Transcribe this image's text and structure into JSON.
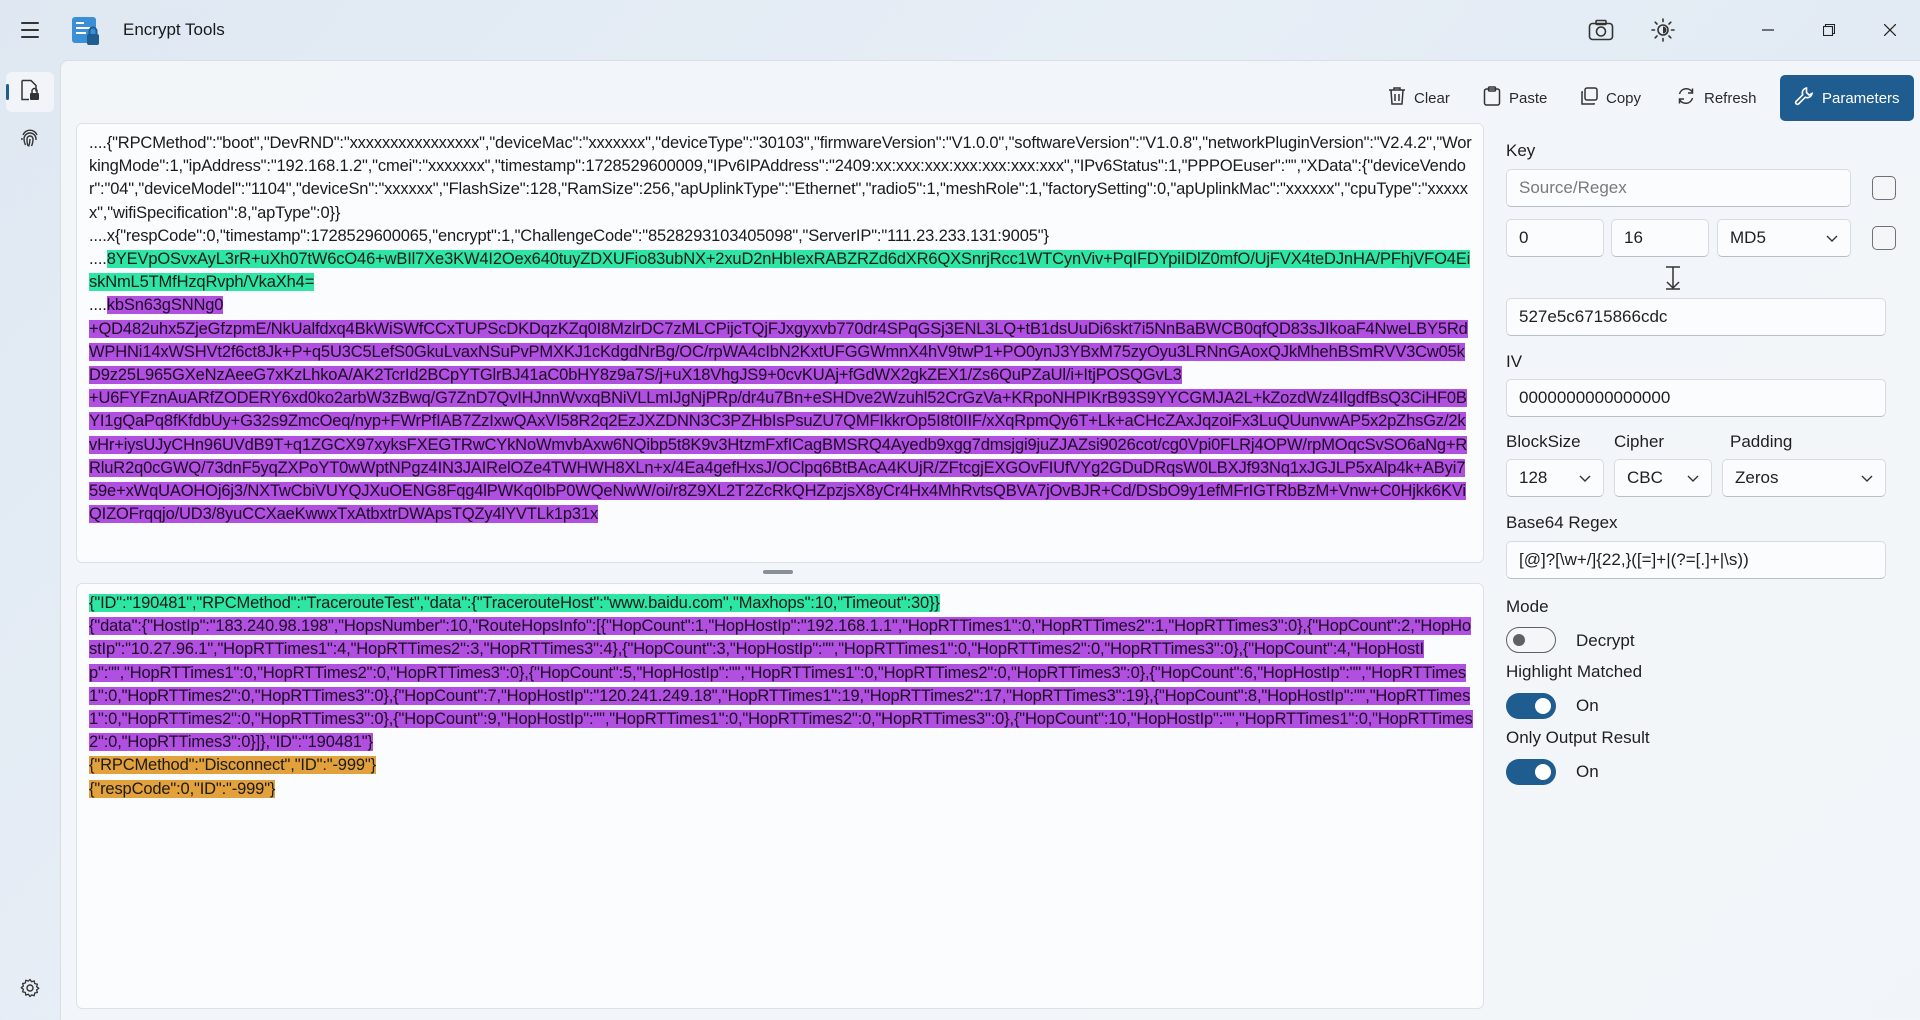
{
  "app": {
    "title": "Encrypt Tools"
  },
  "titlebar_icons": [
    "hamburger-icon",
    "camera-icon",
    "brightness-icon"
  ],
  "toolbar": {
    "clear_label": "Clear",
    "paste_label": "Paste",
    "copy_label": "Copy",
    "refresh_label": "Refresh",
    "parameters_label": "Parameters"
  },
  "input_editor": {
    "lines": [
      {
        "text": "....{\"RPCMethod\":\"boot\",\"DevRND\":\"xxxxxxxxxxxxxxxx\",\"deviceMac\":\"xxxxxxx\",\"deviceType\":\"30103\",\"firmwareVersion\":\"V1.0.0\",\"softwareVersion\":\"V1.0.8\",\"networkPluginVersion\":\"V2.4.2\",\"WorkingMode\":1,\"ipAddress\":\"192.168.1.2\",\"cmei\":\"xxxxxxx\",\"timestamp\":1728529600009,\"IPv6IPAddress\":\"2409:xx:xxx:xxx:xxx:xxx:xxx:xxx\",\"IPv6Status\":1,\"PPPOEuser\":\"\",\"XData\":{\"deviceVendor\":\"04\",\"deviceModel\":\"1104\",\"deviceSn\":\"xxxxxx\",\"FlashSize\":128,\"RamSize\":256,\"apUplinkType\":\"Ethernet\",\"radio5\":1,\"meshRole\":1,\"factorySetting\":0,\"apUplinkMac\":\"xxxxxx\",\"cpuType\":\"xxxxxx\",\"wifiSpecification\":8,\"apType\":0}}",
        "hl": ""
      },
      {
        "text": "....x{\"respCode\":0,\"timestamp\":1728529600065,\"encrypt\":1,\"ChallengeCode\":\"8528293103405098\",\"ServerIP\":\"111.23.233.131:9005\"}",
        "hl": ""
      },
      {
        "prefix": "....",
        "text": "8YEVpOSvxAyL3rR+uXh07tW6cO46+wBIl7Xe3KW4I2Oex640tuyZDXUFio83ubNX+2xuD2nHbIexRABZRZd6dXR6QXSnrjRcc1WTCynViv+PqIFDYpiIDlZ0mfO/UjFVX4teDJnHA/PFhjVFO4EiskNmL5TMfHzqRvph/VkaXh4=",
        "hl": "green"
      },
      {
        "prefix": "....",
        "text": "kbSn63gSNNg0",
        "hl": "purple"
      },
      {
        "text": "+QD482uhx5ZjeGfzpmE/NkUalfdxq4BkWiSWfCCxTUPScDKDqzKZq0I8MzlrDC7zMLCPijcTQjFJxgyxvb770dr4SPqGSj3ENL3LQ+tB1dsUuDi6skt7i5NnBaBWCB0qfQD83sJIkoaF4NweLBY5RdWPHNi14xWSHVt2f6ct8Jk+P+q5U3C5LefS0GkuLvaxNSuPvPMXKJ1cKdgdNrBg/OC/rpWA4cIbN2KxtUFGGWmnX4hV9twP1+PO0ynJ3YBxM75zyOyu3LRNnGAoxQJkMhehBSmRVV3Cw05kD9z25L965GXeNzAeeG7xKzLhkoA/AK2TcrId2BCpYTGlrBJ41aC0bHY8z9a7S/j+uX18VhgJS9+0cvKUAj+fGdWX2gkZEX1/Zs6QuPZaUl/i+ItjPOSQGvL3",
        "hl": "purple"
      },
      {
        "text": "+U6FYFznAuARfZODERY6xd0ko2arbW3zBwq/G7ZnD7QvIHJnnWvxqBNiVLLmIJgNjPRp/dr4u7Bn+eSHDve2Wzuhl52CrGzVa+KRpoNHPIKrB93S9YYCGMJA2L+kZozdWz4IlgdfBsQ3CiHF0BYI1gQaPq8fKfdbUy+G32s9ZmcOeq/nyp+FWrPfIAB7ZzIxwQAxVI58R2q2EzJXZDNN3C3PZHbIsPsuZU7QMFIkkrOp5I8t0IIF/xXqRpmQy6T+Lk+aCHcZAxJqzoiFx3LuQUunvwAP5x2pZhsGz/2kvHr+iysUJyCHn96UVdB9T+q1ZGCX97xyksFXEGTRwCYkNoWmvbAxw6NQibp5t8K9v3HtzmFxfICagBMSRQ4Ayedb9xgg7dmsjgi9juZJAZsi9026cot/cg0Vpi0FLRj4OPW/rpMOqcSvSO6aNg+RRluR2q0cGWQ/73dnF5yqZXPoYT0wWptNPgz4IN3JAIRelOZe4TWHWH8XLn+x/4Ea4gefHxsJ/OClpq6BtBAcA4KUjR/ZFtcgjEXGOvFIUfVYg2GDuDRqsW0LBXJf93Nq1xJGJLP5xAlp4k+AByi759e+xWqUAOHOj6j3/NXTwCbiVUYQJXuOENG8Fqg4lPWKq0IbP0WQeNwW/oi/r8Z9XL2T2ZcRkQHZpzjsX8yCr4Hx4MhRvtsQBVA7jOvBJR+Cd/DSbO9y1efMFrIGTRbBzM+Vnw+C0Hjkk6KViQIZOFrqqjo/UD3/8yuCCXaeKwwxTxAtbxtrDWApsTQZy4lYVTLk1p31x",
        "hl": "purple"
      }
    ]
  },
  "output_editor": {
    "lines": [
      {
        "text": "{\"ID\":\"190481\",\"RPCMethod\":\"TracerouteTest\",\"data\":{\"TracerouteHost\":\"www.baidu.com\",\"Maxhops\":10,\"Timeout\":30}}",
        "hl": "green"
      },
      {
        "text": "{\"data\":{\"HostIp\":\"183.240.98.198\",\"HopsNumber\":10,\"RouteHopsInfo\":[{\"HopCount\":1,\"HopHostIp\":\"192.168.1.1\",\"HopRTTimes1\":0,\"HopRTTimes2\":1,\"HopRTTimes3\":0},{\"HopCount\":2,\"HopHostIp\":\"10.27.96.1\",\"HopRTTimes1\":4,\"HopRTTimes2\":3,\"HopRTTimes3\":4},{\"HopCount\":3,\"HopHostIp\":\"\",\"HopRTTimes1\":0,\"HopRTTimes2\":0,\"HopRTTimes3\":0},{\"HopCount\":4,\"HopHostIp\":\"\",\"HopRTTimes1\":0,\"HopRTTimes2\":0,\"HopRTTimes3\":0},{\"HopCount\":5,\"HopHostIp\":\"\",\"HopRTTimes1\":0,\"HopRTTimes2\":0,\"HopRTTimes3\":0},{\"HopCount\":6,\"HopHostIp\":\"\",\"HopRTTimes1\":0,\"HopRTTimes2\":0,\"HopRTTimes3\":0},{\"HopCount\":7,\"HopHostIp\":\"120.241.249.18\",\"HopRTTimes1\":19,\"HopRTTimes2\":17,\"HopRTTimes3\":19},{\"HopCount\":8,\"HopHostIp\":\"\",\"HopRTTimes1\":0,\"HopRTTimes2\":0,\"HopRTTimes3\":0},{\"HopCount\":9,\"HopHostIp\":\"\",\"HopRTTimes1\":0,\"HopRTTimes2\":0,\"HopRTTimes3\":0},{\"HopCount\":10,\"HopHostIp\":\"\",\"HopRTTimes1\":0,\"HopRTTimes2\":0,\"HopRTTimes3\":0}]},\"ID\":\"190481\"}",
        "hl": "purple"
      },
      {
        "text": "{\"RPCMethod\":\"Disconnect\",\"ID\":\"-999\"}",
        "hl": "orange"
      },
      {
        "text": "{\"respCode\":0,\"ID\":\"-999\"}",
        "hl": "orange"
      }
    ]
  },
  "params": {
    "key_label": "Key",
    "source_placeholder": "Source/Regex",
    "start_value": "0",
    "length_value": "16",
    "hash_value": "MD5",
    "key_value": "527e5c6715866cdc",
    "iv_label": "IV",
    "iv_value": "0000000000000000",
    "blocksize_label": "BlockSize",
    "cipher_label": "Cipher",
    "padding_label": "Padding",
    "blocksize_value": "128",
    "cipher_value": "CBC",
    "padding_value": "Zeros",
    "base64_label": "Base64 Regex",
    "base64_value": "[@]?[\\w+/]{22,}([=]+|(?=[.]+|\\s))",
    "mode_label": "Mode",
    "mode_state": "Decrypt",
    "highlight_label": "Highlight Matched",
    "highlight_state": "On",
    "only_output_label": "Only Output Result",
    "only_output_state": "On"
  },
  "colors": {
    "accent": "#1f5c8f",
    "highlight_green": "#2ee6a3",
    "highlight_purple": "#b04fe0",
    "highlight_orange": "#e3a13b"
  }
}
